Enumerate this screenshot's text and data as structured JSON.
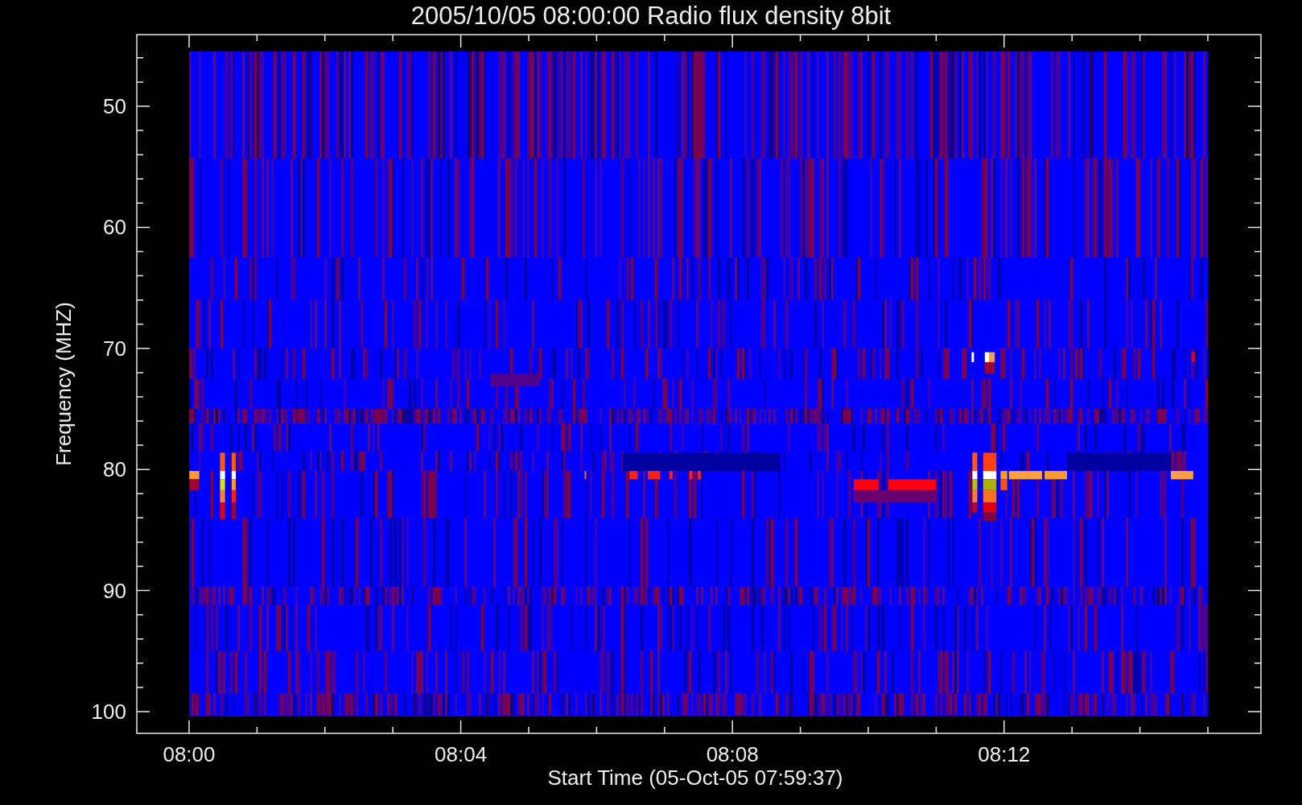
{
  "title": "2005/10/05 08:00:00 Radio flux density 8bit",
  "y_axis": {
    "label": "Frequency (MHZ)",
    "ticks": [
      "50",
      "60",
      "70",
      "80",
      "90",
      "100"
    ]
  },
  "x_axis": {
    "label": "Start Time (05-Oct-05 07:59:37)",
    "ticks": [
      "08:00",
      "08:04",
      "08:08",
      "08:12"
    ]
  }
}
